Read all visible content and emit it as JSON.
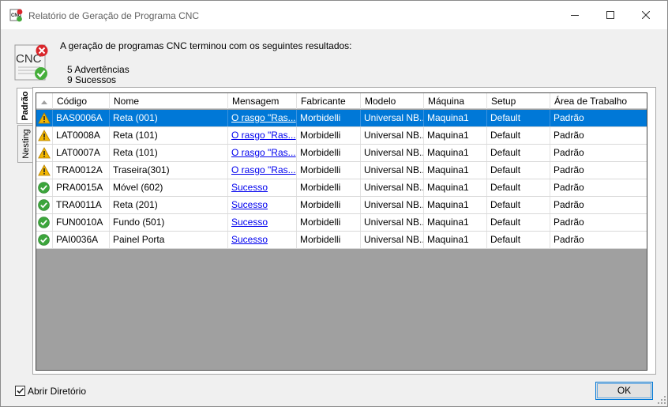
{
  "window": {
    "title": "Relatório de Geração de Programa CNC",
    "app_icon": "cnc-app-icon",
    "controls": [
      "minimize-icon",
      "maximize-icon",
      "close-icon"
    ]
  },
  "header": {
    "icon": "cnc-report-icon",
    "icon_text": "CNC",
    "summary": "A geração de programas CNC terminou com os seguintes resultados:",
    "warnings_count": "5 Advertências",
    "success_count": "9 Sucessos"
  },
  "tabs": [
    "Padrão",
    "Nesting"
  ],
  "grid": {
    "columns": [
      "Código",
      "Nome",
      "Mensagem",
      "Fabricante",
      "Modelo",
      "Máquina",
      "Setup",
      "Área de Trabalho"
    ],
    "rows": [
      {
        "status": "warning",
        "codigo": "BAS0006A",
        "nome": "Reta (001)",
        "mensagem": "O rasgo \"Ras...",
        "fabricante": "Morbidelli",
        "modelo": "Universal NB...",
        "maquina": "Maquina1",
        "setup": "Default",
        "area": "Padrão"
      },
      {
        "status": "warning",
        "codigo": "LAT0008A",
        "nome": "Reta (101)",
        "mensagem": "O rasgo \"Ras...",
        "fabricante": "Morbidelli",
        "modelo": "Universal NB...",
        "maquina": "Maquina1",
        "setup": "Default",
        "area": "Padrão"
      },
      {
        "status": "warning",
        "codigo": "LAT0007A",
        "nome": "Reta (101)",
        "mensagem": "O rasgo \"Ras...",
        "fabricante": "Morbidelli",
        "modelo": "Universal NB...",
        "maquina": "Maquina1",
        "setup": "Default",
        "area": "Padrão"
      },
      {
        "status": "warning",
        "codigo": "TRA0012A",
        "nome": "Traseira(301)",
        "mensagem": "O rasgo \"Ras...",
        "fabricante": "Morbidelli",
        "modelo": "Universal NB...",
        "maquina": "Maquina1",
        "setup": "Default",
        "area": "Padrão"
      },
      {
        "status": "success",
        "codigo": "PRA0015A",
        "nome": "Móvel (602)",
        "mensagem": "Sucesso",
        "fabricante": "Morbidelli",
        "modelo": "Universal NB...",
        "maquina": "Maquina1",
        "setup": "Default",
        "area": "Padrão"
      },
      {
        "status": "success",
        "codigo": "TRA0011A",
        "nome": "Reta (201)",
        "mensagem": "Sucesso",
        "fabricante": "Morbidelli",
        "modelo": "Universal NB...",
        "maquina": "Maquina1",
        "setup": "Default",
        "area": "Padrão"
      },
      {
        "status": "success",
        "codigo": "FUN0010A",
        "nome": "Fundo (501)",
        "mensagem": "Sucesso",
        "fabricante": "Morbidelli",
        "modelo": "Universal NB...",
        "maquina": "Maquina1",
        "setup": "Default",
        "area": "Padrão"
      },
      {
        "status": "success",
        "codigo": "PAI0036A",
        "nome": "Painel Porta",
        "mensagem": "Sucesso",
        "fabricante": "Morbidelli",
        "modelo": "Universal NB...",
        "maquina": "Maquina1",
        "setup": "Default",
        "area": "Padrão"
      }
    ],
    "selected_row": 0
  },
  "footer": {
    "open_dir_label": "Abrir Diretório",
    "open_dir_checked": true,
    "ok_label": "OK"
  },
  "colors": {
    "selection": "#0078d7",
    "warning": "#f2b600",
    "success": "#3ca53c",
    "link": "#0000ee",
    "grid_background": "#a0a0a0"
  }
}
